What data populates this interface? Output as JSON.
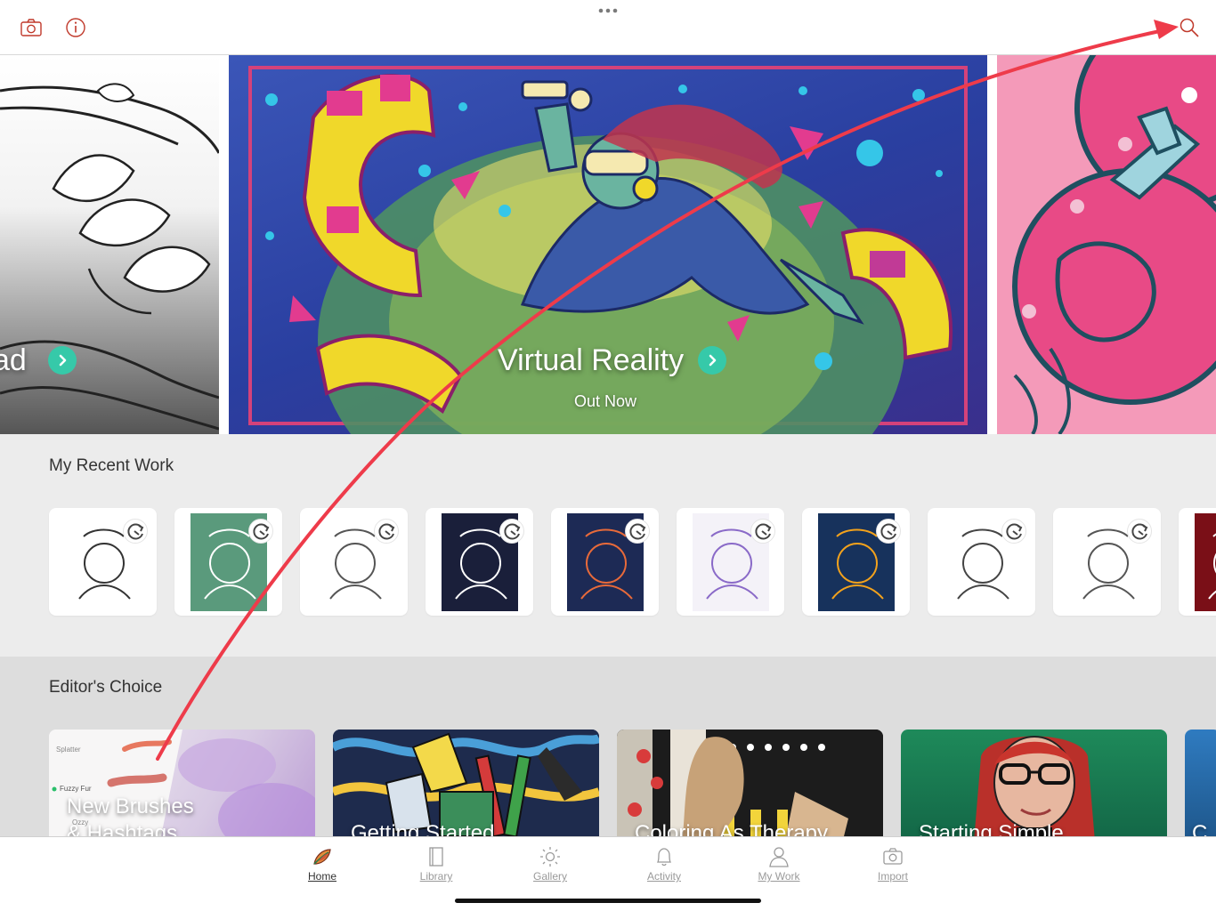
{
  "topbar": {
    "camera_icon": "camera-icon",
    "info_icon": "info-icon",
    "more_icon": "more-dots-icon",
    "search_icon": "search-icon"
  },
  "hero": {
    "slides": [
      {
        "title": "ad",
        "subtitle": ""
      },
      {
        "title": "Virtual Reality",
        "subtitle": "Out Now"
      },
      {
        "title": "",
        "subtitle": ""
      }
    ],
    "go_icon": "chevron-right-icon"
  },
  "recent_work": {
    "title": "My Recent Work",
    "items": [
      {
        "name": "flower-sketch",
        "bg": "#ffffff",
        "accent": "#333333"
      },
      {
        "name": "peace-happiness",
        "bg": "#5a9a7c",
        "accent": "#ffffff"
      },
      {
        "name": "hashtag-doodle",
        "bg": "#ffffff",
        "accent": "#555555"
      },
      {
        "name": "do-what-is-right",
        "bg": "#1a1f3a",
        "accent": "#ffffff"
      },
      {
        "name": "space-rocket",
        "bg": "#1d2a55",
        "accent": "#e86a3a"
      },
      {
        "name": "mandala",
        "bg": "#f4f2f8",
        "accent": "#8a6ac8"
      },
      {
        "name": "sun-moon",
        "bg": "#17325c",
        "accent": "#f3a21c"
      },
      {
        "name": "unicorn-outline",
        "bg": "#ffffff",
        "accent": "#444444"
      },
      {
        "name": "city-doodle",
        "bg": "#ffffff",
        "accent": "#555555"
      },
      {
        "name": "red-leaf",
        "bg": "#7a0f17",
        "accent": "#ffffff"
      }
    ]
  },
  "editors_choice": {
    "title": "Editor's Choice",
    "cards": [
      {
        "title_line1": "New Brushes",
        "title_line2": "& Hashtags",
        "swatch1": "Splatter",
        "swatch2": "Fuzzy Fur",
        "swatch3": "Ozzy"
      },
      {
        "title_line1": "Getting Started",
        "title_line2": ""
      },
      {
        "title_line1": "Coloring As Therapy",
        "title_line2": ""
      },
      {
        "title_line1": "Starting Simple",
        "title_line2": ""
      },
      {
        "title_line1": "C",
        "title_line2": ""
      }
    ]
  },
  "tabbar": {
    "tabs": [
      {
        "label": "Home",
        "icon": "home-leaf-icon",
        "active": true
      },
      {
        "label": "Library",
        "icon": "library-book-icon",
        "active": false
      },
      {
        "label": "Gallery",
        "icon": "gallery-sun-icon",
        "active": false
      },
      {
        "label": "Activity",
        "icon": "activity-bell-icon",
        "active": false
      },
      {
        "label": "My Work",
        "icon": "my-work-person-icon",
        "active": false
      },
      {
        "label": "Import",
        "icon": "import-camera-icon",
        "active": false
      }
    ]
  },
  "colors": {
    "accent": "#c0392b",
    "go_button": "#36c9a9",
    "annotation_arrow": "#ee3b4a"
  }
}
